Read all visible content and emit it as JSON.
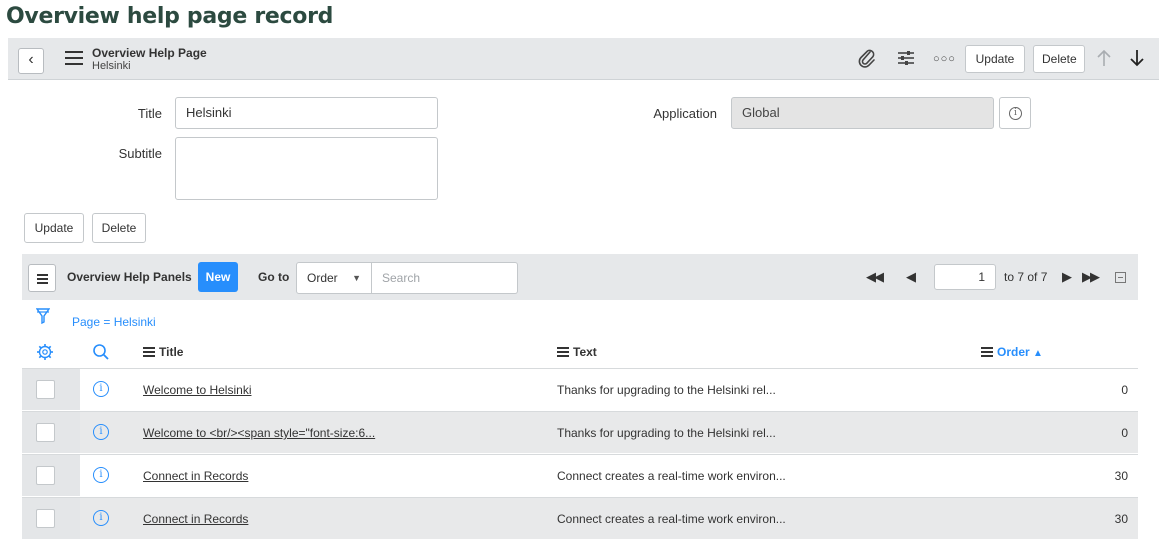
{
  "page_heading": "Overview help page record",
  "header": {
    "title": "Overview Help Page",
    "subtitle": "Helsinki",
    "update_label": "Update",
    "delete_label": "Delete"
  },
  "form": {
    "title_label": "Title",
    "title_value": "Helsinki",
    "subtitle_label": "Subtitle",
    "subtitle_value": "",
    "application_label": "Application",
    "application_value": "Global",
    "update_label": "Update",
    "delete_label": "Delete"
  },
  "list": {
    "title": "Overview Help Panels",
    "new_label": "New",
    "goto_label": "Go to",
    "goto_field": "Order",
    "search_placeholder": "Search",
    "page_value": "1",
    "page_of": "to 7 of 7",
    "filter_text": "Page = Helsinki",
    "columns": {
      "title": "Title",
      "text": "Text",
      "order": "Order"
    },
    "rows": [
      {
        "title": "Welcome to Helsinki",
        "text": "Thanks for upgrading to the Helsinki rel...",
        "order": "0"
      },
      {
        "title": "Welcome to <br/><span style=\"font-size:6...",
        "text": "Thanks for upgrading to the Helsinki rel...",
        "order": "0"
      },
      {
        "title": "Connect in Records",
        "text": "Connect creates a real-time work environ...",
        "order": "30"
      },
      {
        "title": "Connect in Records",
        "text": "Connect creates a real-time work environ...",
        "order": "30"
      }
    ]
  },
  "colors": {
    "accent": "#278efc",
    "header_bg": "#e6e8ea",
    "heading": "#2c4a40"
  },
  "icons": [
    "back-icon",
    "hamburger-icon",
    "paperclip-icon",
    "settings-sliders-icon",
    "more-icon",
    "arrow-up-icon",
    "arrow-down-icon",
    "info-icon",
    "filter-icon",
    "gear-icon",
    "search-icon",
    "first-page-icon",
    "prev-page-icon",
    "next-page-icon",
    "last-page-icon",
    "collapse-icon"
  ]
}
